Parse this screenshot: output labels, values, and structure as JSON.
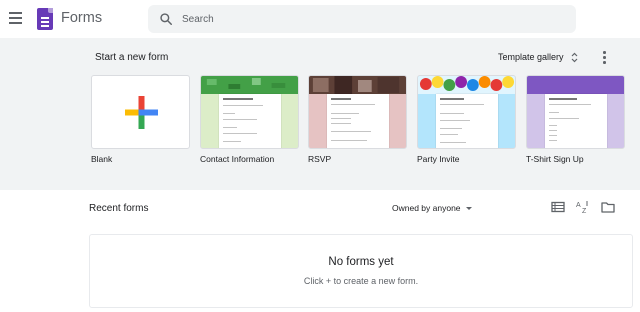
{
  "header": {
    "app_title": "Forms",
    "search_placeholder": "Search",
    "icons": [
      "menu-icon",
      "forms-logo-icon",
      "search-icon"
    ]
  },
  "templates_section": {
    "title": "Start a new form",
    "gallery_label": "Template gallery",
    "items": [
      {
        "label": "Blank",
        "accent": "#ffffff"
      },
      {
        "label": "Contact Information",
        "accent": "#dcedc8"
      },
      {
        "label": "RSVP",
        "accent": "#e6c3c3"
      },
      {
        "label": "Party Invite",
        "accent": "#b3e5fc"
      },
      {
        "label": "T-Shirt Sign Up",
        "accent": "#d1c4e9"
      }
    ]
  },
  "recent": {
    "title": "Recent forms",
    "owner_filter": "Owned by anyone",
    "empty_title": "No forms yet",
    "empty_subtitle": "Click + to create a new form."
  },
  "colors": {
    "brand": "#673ab7",
    "gallery_bg": "#f1f3f4",
    "google_blue": "#4285f4",
    "google_red": "#ea4335",
    "google_yellow": "#fbbc04",
    "google_green": "#34a853"
  }
}
